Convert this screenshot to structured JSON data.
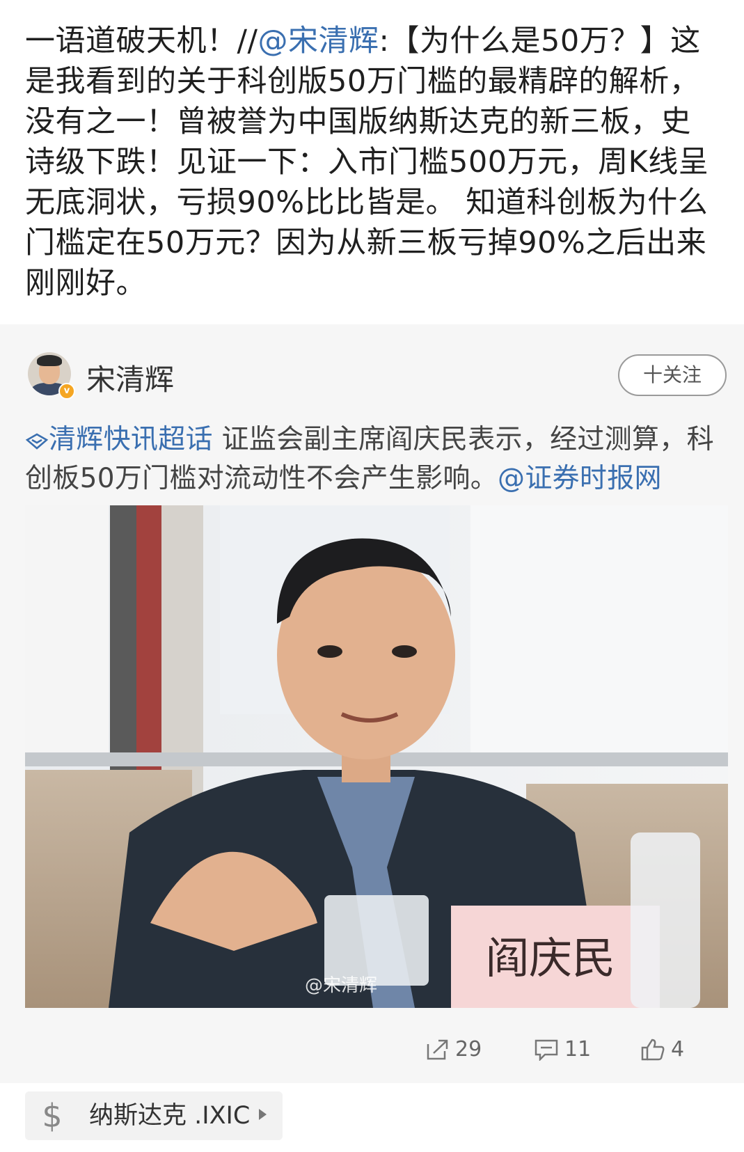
{
  "repost": {
    "lead": "一语道破天机！//",
    "mention": "@宋清辉",
    "rest": ":【为什么是50万？】这是我看到的关于科创版50万门槛的最精辟的解析，没有之一！曾被誉为中国版纳斯达克的新三板，史诗级下跌！见证一下：入市门槛500万元，周K线呈无底洞状，亏损90%比比皆是。 知道科创板为什么门槛定在50万元？因为从新三板亏掉90%之后出来刚刚好。"
  },
  "original": {
    "username": "宋清辉",
    "verified_mark": "v",
    "follow_label": "十关注",
    "topic": "清辉快讯超话",
    "body": " 证监会副主席阎庆民表示，经过测算，科创板50万门槛对流动性不会产生影响。",
    "source_mention": "@证券时报网",
    "photo": {
      "nameplate": "阎庆民",
      "watermark": "@宋清辉"
    }
  },
  "actions": {
    "share_count": "29",
    "comment_count": "11",
    "like_count": "4"
  },
  "stock": {
    "icon": "$",
    "label": "纳斯达克 .IXIC"
  },
  "colors": {
    "link": "#3a6fb0",
    "card_bg": "#f6f6f6",
    "badge": "#f5a623"
  }
}
